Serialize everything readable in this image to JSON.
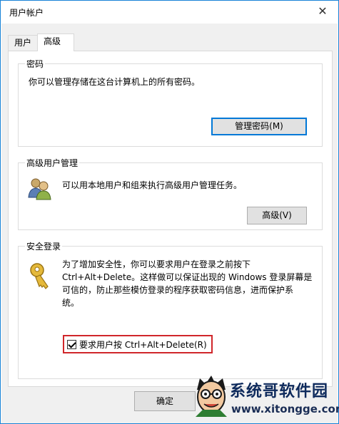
{
  "window": {
    "title": "用户帐户"
  },
  "tabs": [
    {
      "label": "用户"
    },
    {
      "label": "高级"
    }
  ],
  "passwords": {
    "title": "密码",
    "description": "你可以管理存储在这台计算机上的所有密码。",
    "button": "管理密码(M)"
  },
  "advanced_user_mgmt": {
    "title": "高级用户管理",
    "description": "可以用本地用户和组来执行高级用户管理任务。",
    "button": "高级(V)"
  },
  "secure_logon": {
    "title": "安全登录",
    "line1": "为了增加安全性，你可以要求用户在登录之前按下",
    "line2": "Ctrl+Alt+Delete。这样做可以保证出现的 Windows 登录屏幕是",
    "line3": "可信的，防止那些模仿登录的程序获取密码信息，进而保护系",
    "line4": "统。",
    "checkbox_label": "要求用户按 Ctrl+Alt+Delete(R)",
    "checkbox_checked": true
  },
  "footer": {
    "ok_button": "确定"
  },
  "watermark": {
    "name": "系统哥软件园",
    "url": "www.xitongge.com"
  },
  "colors": {
    "highlight_border": "#d0262a",
    "focus_blue": "#0078d7"
  }
}
